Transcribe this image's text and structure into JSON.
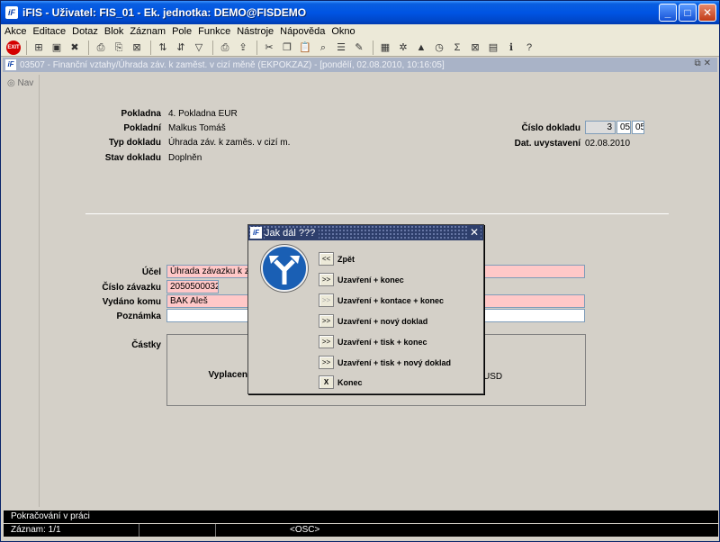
{
  "window": {
    "title": "iFIS - Uživatel: FIS_01 - Ek. jednotka: DEMO@FISDEMO",
    "app_icon": "iF",
    "buttons": [
      "_",
      "□",
      "✕"
    ]
  },
  "menu": [
    "Akce",
    "Editace",
    "Dotaz",
    "Blok",
    "Záznam",
    "Pole",
    "Funkce",
    "Nástroje",
    "Nápověda",
    "Okno"
  ],
  "toolbar": {
    "exit_label": "EXIT"
  },
  "form": {
    "title": "03507 - Finanční vztahy/Úhrada záv. k zaměst. v cizí měně (EKPOKZAZ) - [pondělí, 02.08.2010, 10:16:05]",
    "nav_label": "Nav",
    "pokladna_label": "Pokladna",
    "pokladna_value": "4. Pokladna EUR",
    "pokladni_label": "Pokladní",
    "pokladni_value": "Malkus Tomáš",
    "typ_label": "Typ dokladu",
    "typ_value": "Úhrada záv. k zaměs. v cizí m.",
    "stav_label": "Stav dokladu",
    "stav_value": "Doplněn",
    "cislo_dokladu_label": "Číslo dokladu",
    "cislo_dokladu_parts": [
      "3",
      "05",
      "05"
    ],
    "dat_label": "Dat. uvystavení",
    "dat_value": "02.08.2010",
    "ucel_label": "Účel",
    "ucel_value": "Úhrada závazku k zam",
    "cislo_zavazku_label": "Číslo závazku",
    "cislo_zavazku_value": "2050500032",
    "vydano_label": "Vydáno komu",
    "vydano_value": "BAK Aleš",
    "poznamka_label": "Poznámka",
    "poznamka_value": "",
    "castky_label": "Částky",
    "vyplaceno_label": "Vyplacen",
    "currency": "USD"
  },
  "dialog": {
    "title": "Jak dál ???",
    "close": "✕",
    "options": [
      {
        "btn": "<<",
        "label": "Zpět",
        "dim": false
      },
      {
        "btn": ">>",
        "label": "Uzavření + konec",
        "dim": false
      },
      {
        "btn": ">>",
        "label": "Uzavření + kontace + konec",
        "dim": true
      },
      {
        "btn": ">>",
        "label": "Uzavření + nový doklad",
        "dim": false
      },
      {
        "btn": ">>",
        "label": "Uzavření + tisk + konec",
        "dim": false
      },
      {
        "btn": ">>",
        "label": "Uzavření + tisk + nový doklad",
        "dim": false
      },
      {
        "btn": "X",
        "label": "Konec",
        "dim": false
      }
    ]
  },
  "status": {
    "message": "Pokračování v práci",
    "record": "Záznam: 1/1",
    "mode": "<OSC>"
  }
}
